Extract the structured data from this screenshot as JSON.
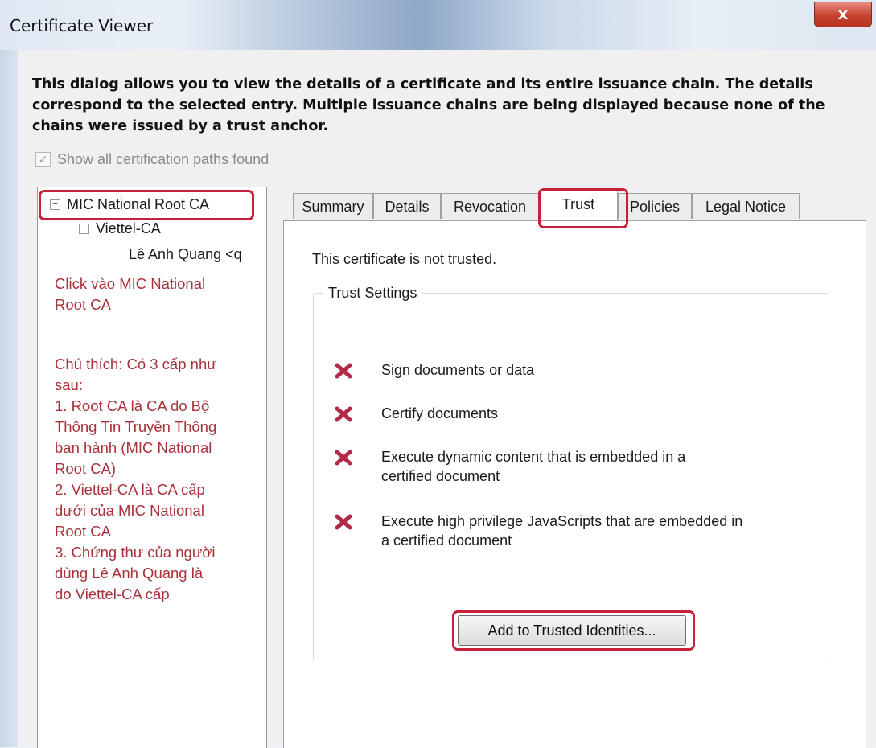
{
  "window": {
    "title": "Certificate Viewer",
    "close_label": "x"
  },
  "intro_text": "This dialog allows you to view the details of a certificate and its entire issuance chain. The details correspond to the selected entry. Multiple issuance chains are being displayed because none of the chains were issued by a trust anchor.",
  "show_paths": {
    "label": "Show all certification paths found",
    "checked": true
  },
  "tree": {
    "root": "MIC National Root CA",
    "intermediate": "Viettel-CA",
    "leaf": "Lê Anh Quang <q"
  },
  "annotation": {
    "click_hint_1": "Click vào MIC National",
    "click_hint_2": "Root CA",
    "notes": [
      "Chú thích: Có 3 cấp như",
      "sau:",
      "1. Root CA là CA do Bộ",
      "Thông Tin Truyền Thông",
      "ban hành (MIC National",
      "Root CA)",
      "2. Viettel-CA là CA cấp",
      "dưới của MIC National",
      "Root CA",
      "3. Chứng thư của người",
      "dùng Lê Anh Quang là",
      "do Viettel-CA cấp"
    ]
  },
  "tabs": [
    "Summary",
    "Details",
    "Revocation",
    "Trust",
    "Policies",
    "Legal Notice"
  ],
  "active_tab": "Trust",
  "trust": {
    "status": "This certificate is not trusted.",
    "group_label": "Trust Settings",
    "items": [
      {
        "line1": "Sign documents or data",
        "line2": ""
      },
      {
        "line1": "Certify documents",
        "line2": ""
      },
      {
        "line1": "Execute dynamic content that is embedded in a",
        "line2": "certified document"
      },
      {
        "line1": "Execute high privilege JavaScripts that are embedded in",
        "line2": "a certified document"
      }
    ],
    "add_button": "Add to Trusted Identities..."
  },
  "colors": {
    "annotation": "#a8323a",
    "highlight": "#c8203a",
    "x_icon": "#b22a47"
  }
}
